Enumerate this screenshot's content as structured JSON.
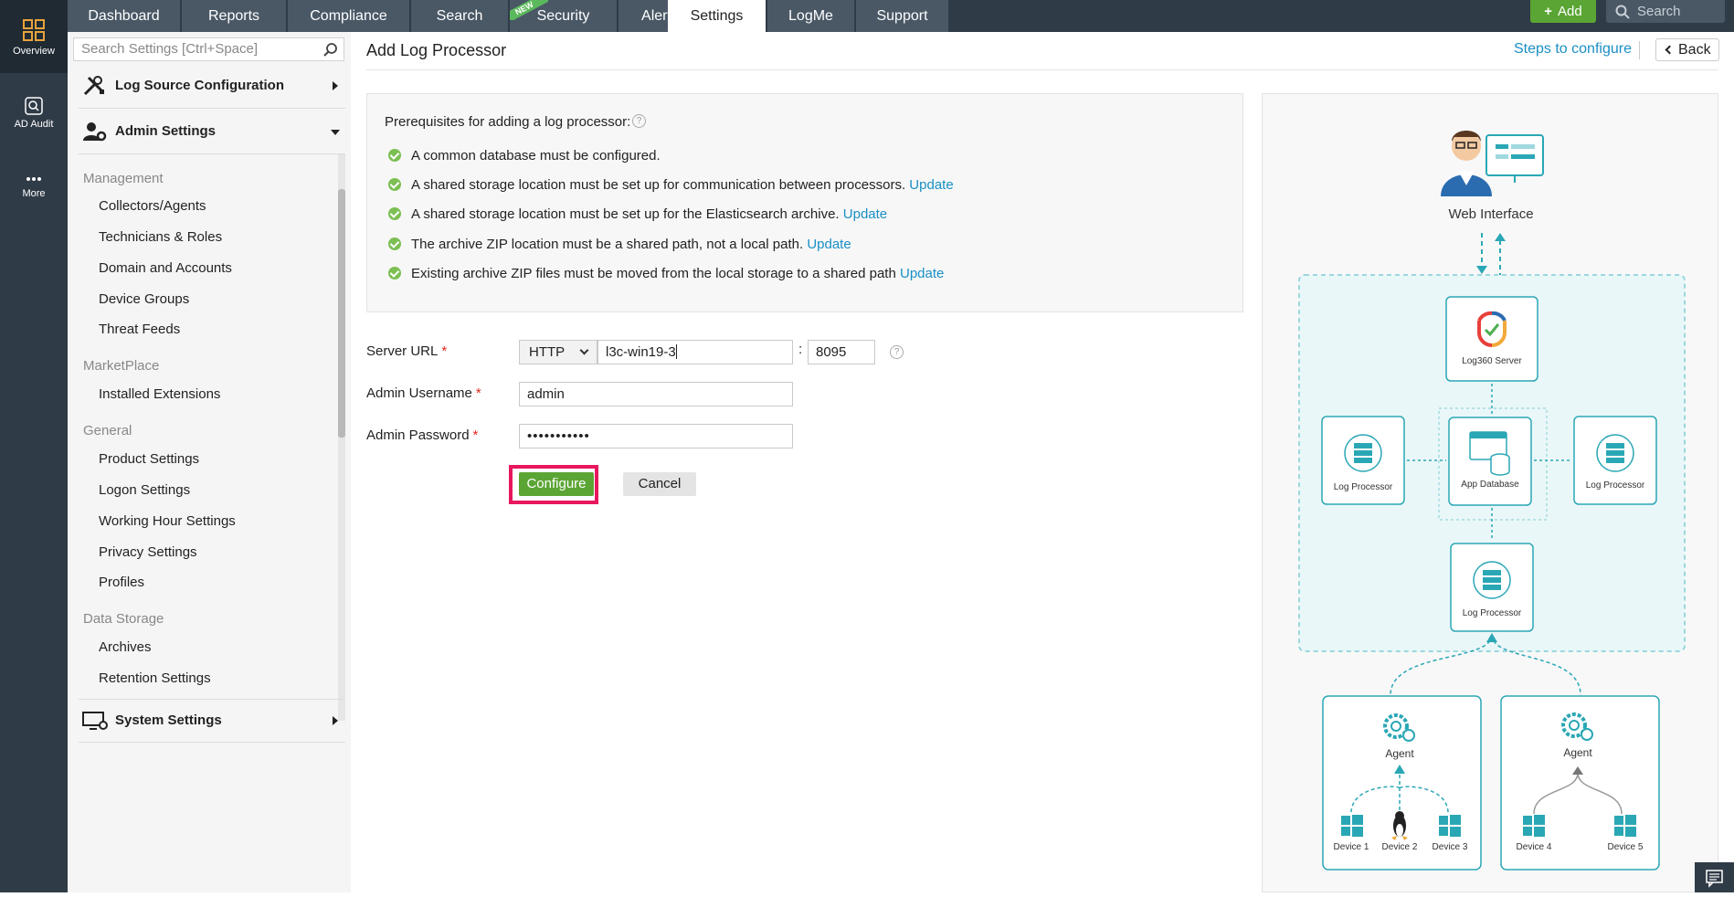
{
  "rail": {
    "items": [
      {
        "label": "Overview",
        "icon": "grid-icon"
      },
      {
        "label": "AD Audit",
        "icon": "search-icon"
      },
      {
        "label": "More",
        "icon": "more-icon"
      }
    ]
  },
  "topnav": {
    "tabs": [
      "Dashboard",
      "Reports",
      "Compliance",
      "Search",
      "Security",
      "Alerts",
      "Settings",
      "LogMe",
      "Support"
    ],
    "new_badge": "NEW",
    "add_label": "Add",
    "search_placeholder": "Search"
  },
  "sidebar": {
    "search_placeholder": "Search Settings [Ctrl+Space]",
    "log_source": "Log Source Configuration",
    "admin_settings": "Admin Settings",
    "groups": [
      {
        "title": "Management",
        "items": [
          "Collectors/Agents",
          "Technicians & Roles",
          "Domain and Accounts",
          "Device Groups",
          "Threat Feeds"
        ]
      },
      {
        "title": "MarketPlace",
        "items": [
          "Installed Extensions"
        ]
      },
      {
        "title": "General",
        "items": [
          "Product Settings",
          "Logon Settings",
          "Working Hour Settings",
          "Privacy Settings",
          "Profiles"
        ]
      },
      {
        "title": "Data Storage",
        "items": [
          "Archives",
          "Retention Settings"
        ]
      }
    ],
    "system_settings": "System Settings"
  },
  "main": {
    "title": "Add Log Processor",
    "steps_link": "Steps to configure",
    "back_label": "Back",
    "prereq": {
      "title": "Prerequisites for adding a log processor:",
      "items": [
        {
          "text": "A common database must be configured.",
          "link": ""
        },
        {
          "text": "A shared storage location must be set up for communication between processors.",
          "link": "Update"
        },
        {
          "text": "A shared storage location must be set up for the Elasticsearch archive.",
          "link": "Update"
        },
        {
          "text": "The archive ZIP location must be a shared path, not a local path.",
          "link": "Update"
        },
        {
          "text": "Existing archive ZIP files must be moved from the local storage to a shared path",
          "link": "Update"
        }
      ]
    },
    "form": {
      "server_url_label": "Server URL",
      "protocol": "HTTP",
      "host": "l3c-win19-3",
      "port": "8095",
      "username_label": "Admin Username",
      "username": "admin",
      "password_label": "Admin Password",
      "password": "•••••••••••",
      "required_mark": "*",
      "colon": ":",
      "configure_label": "Configure",
      "cancel_label": "Cancel"
    },
    "diagram": {
      "web_interface": "Web Interface",
      "server": "Log360 Server",
      "app_db": "App Database",
      "log_processor": "Log Processor",
      "agent": "Agent",
      "devices": [
        "Device 1",
        "Device 2",
        "Device 3",
        "Device 4",
        "Device 5"
      ]
    }
  },
  "colors": {
    "accent": "#1a8fc6",
    "nav": "#2f3b47",
    "green": "#5ba534",
    "highlight": "#e8175d",
    "teal": "#2aa7b5"
  }
}
